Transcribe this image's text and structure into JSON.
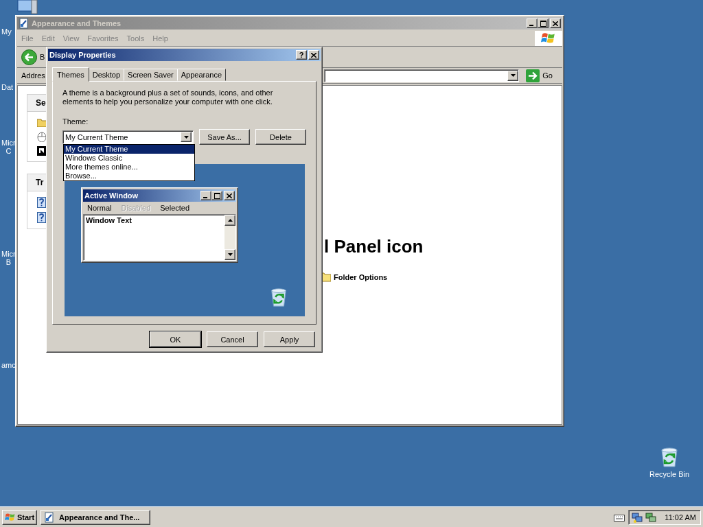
{
  "desktop": {
    "icons": [
      {
        "lines": [
          "My"
        ]
      },
      {
        "lines": [
          "Dat"
        ]
      },
      {
        "lines": [
          "Micr",
          "C"
        ]
      },
      {
        "lines": [
          "Micr",
          "B"
        ]
      },
      {
        "lines": [
          "amc"
        ]
      }
    ],
    "recycle_bin": {
      "label": "Recycle Bin"
    }
  },
  "explorer": {
    "title": "Appearance and Themes",
    "menu": [
      "File",
      "Edit",
      "View",
      "Favorites",
      "Tools",
      "Help"
    ],
    "back_label": "B",
    "address_label": "Addres",
    "go_label": "Go",
    "task_panes": [
      {
        "title": "Se"
      },
      {
        "title": "Tr"
      }
    ],
    "heading": "l Panel icon",
    "links": [
      {
        "label": "Folder Options"
      }
    ]
  },
  "dialog": {
    "title": "Display Properties",
    "help": "?",
    "tabs": [
      {
        "label": "Themes",
        "selected": true
      },
      {
        "label": "Desktop",
        "selected": false
      },
      {
        "label": "Screen Saver",
        "selected": false
      },
      {
        "label": "Appearance",
        "selected": false
      }
    ],
    "description": "A theme is a background plus a set of sounds, icons, and other elements to help you personalize your computer with one click.",
    "theme_label": "Theme:",
    "theme_value": "My Current Theme",
    "side_buttons": [
      "Save As...",
      "Delete"
    ],
    "dropdown": [
      {
        "label": "My Current Theme",
        "selected": true
      },
      {
        "label": "Windows Classic",
        "selected": false
      },
      {
        "label": "More themes online...",
        "selected": false
      },
      {
        "label": "Browse...",
        "selected": false
      }
    ],
    "preview": {
      "window_title": "Active Window",
      "menu": [
        {
          "label": "Normal",
          "disabled": false
        },
        {
          "label": "Disabled",
          "disabled": true
        },
        {
          "label": "Selected",
          "disabled": false
        }
      ],
      "window_text": "Window Text"
    },
    "buttons": [
      "OK",
      "Cancel",
      "Apply"
    ]
  },
  "taskbar": {
    "start": "Start",
    "tasks": [
      {
        "label": "Appearance and The..."
      }
    ],
    "clock": "11:02 AM"
  }
}
